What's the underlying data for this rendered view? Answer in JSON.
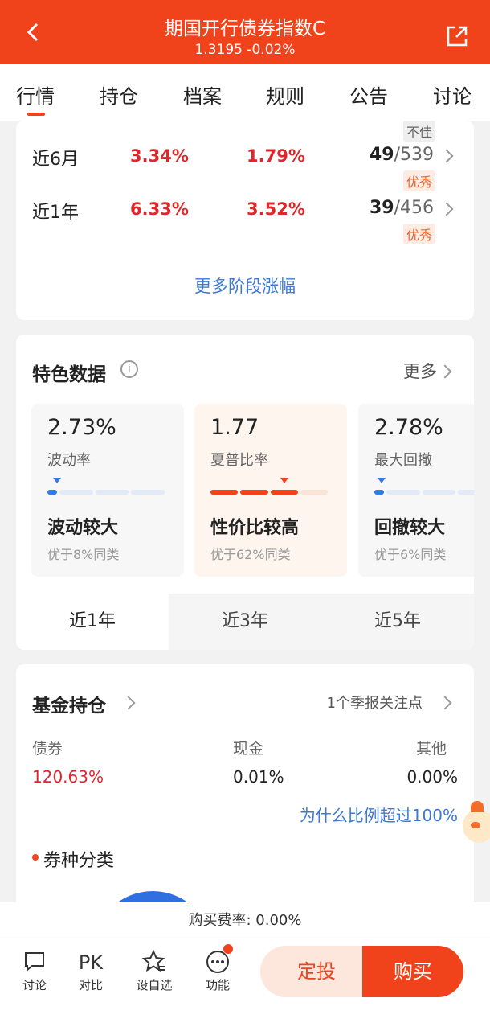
{
  "header": {
    "title": "期国开行债券指数C",
    "subtitle": "1.3195 -0.02%"
  },
  "tabs": [
    "行情",
    "持仓",
    "档案",
    "规则",
    "公告",
    "讨论"
  ],
  "perf": {
    "prev_tag": "不佳",
    "rows": [
      {
        "label": "近6月",
        "v1": "3.34%",
        "v2": "1.79%",
        "rank": "49",
        "total": "/539",
        "tag": "优秀"
      },
      {
        "label": "近1年",
        "v1": "6.33%",
        "v2": "3.52%",
        "rank": "39",
        "total": "/456",
        "tag": "优秀"
      }
    ],
    "more": "更多阶段涨幅"
  },
  "features": {
    "title": "特色数据",
    "more": "更多",
    "metrics": [
      {
        "value": "2.73%",
        "label": "波动率",
        "verdict": "波动较大",
        "pct": "优于8%同类"
      },
      {
        "value": "1.77",
        "label": "夏普比率",
        "verdict": "性价比较高",
        "pct": "优于62%同类"
      },
      {
        "value": "2.78%",
        "label": "最大回撤",
        "verdict": "回撤较大",
        "pct": "优于6%同类"
      }
    ],
    "periods": [
      "近1年",
      "近3年",
      "近5年"
    ]
  },
  "holdings": {
    "title": "基金持仓",
    "note": "1个季报关注点",
    "cols": [
      {
        "label": "债券",
        "value": "120.63%"
      },
      {
        "label": "现金",
        "value": "0.01%"
      },
      {
        "label": "其他",
        "value": "0.00%"
      }
    ],
    "why": "为什么比例超过100%",
    "category": "券种分类"
  },
  "fee": "购买费率: 0.00%",
  "bottom": {
    "items": [
      {
        "icon": "",
        "label": "讨论"
      },
      {
        "icon": "PK",
        "label": "对比"
      },
      {
        "icon": "",
        "label": "设自选"
      },
      {
        "icon": "",
        "label": "功能"
      }
    ],
    "ding": "定投",
    "buy": "购买"
  }
}
